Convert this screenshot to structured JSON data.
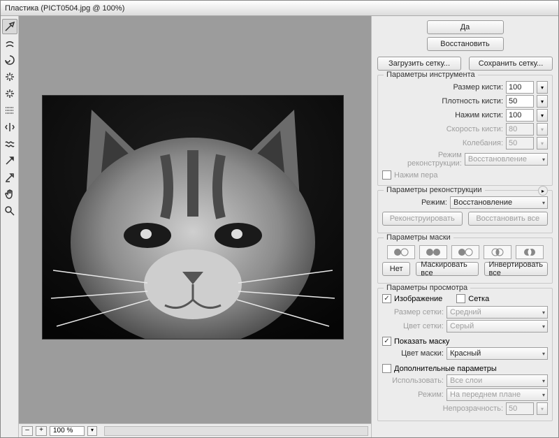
{
  "title": "Пластика (PICT0504.jpg @ 100%)",
  "buttons": {
    "ok": "Да",
    "restore": "Восстановить",
    "load_mesh": "Загрузить сетку...",
    "save_mesh": "Сохранить сетку..."
  },
  "tool_opts": {
    "title": "Параметры инструмента",
    "brush_size": {
      "label": "Размер кисти:",
      "value": "100"
    },
    "brush_density": {
      "label": "Плотность кисти:",
      "value": "50"
    },
    "brush_pressure": {
      "label": "Нажим кисти:",
      "value": "100"
    },
    "brush_rate": {
      "label": "Скорость кисти:",
      "value": "80"
    },
    "turbulence": {
      "label": "Колебания:",
      "value": "50"
    },
    "recon_mode": {
      "label": "Режим реконструкции:",
      "value": "Восстановление"
    },
    "stylus": "Нажим пера"
  },
  "recon_opts": {
    "title": "Параметры реконструкции",
    "mode": {
      "label": "Режим:",
      "value": "Восстановление"
    },
    "reconstruct": "Реконструировать",
    "restore_all": "Восстановить все"
  },
  "mask_opts": {
    "title": "Параметры маски",
    "none": "Нет",
    "mask_all": "Маскировать все",
    "invert_all": "Инвертировать все"
  },
  "view_opts": {
    "title": "Параметры просмотра",
    "image": "Изображение",
    "mesh": "Сетка",
    "mesh_size": {
      "label": "Размер сетки:",
      "value": "Средний"
    },
    "mesh_color": {
      "label": "Цвет сетки:",
      "value": "Серый"
    },
    "show_mask": "Показать маску",
    "mask_color": {
      "label": "Цвет маски:",
      "value": "Красный"
    },
    "extra": "Дополнительные параметры",
    "use": {
      "label": "Использовать:",
      "value": "Все слои"
    },
    "mode": {
      "label": "Режим:",
      "value": "На переднем плане"
    },
    "opacity": {
      "label": "Непрозрачность:",
      "value": "50"
    }
  },
  "zoom": {
    "minus": "–",
    "plus": "+",
    "value": "100 %"
  }
}
